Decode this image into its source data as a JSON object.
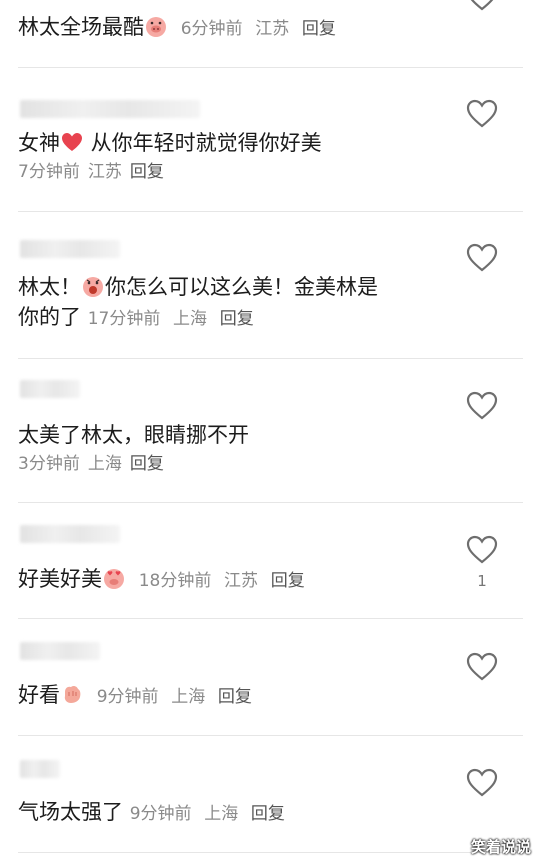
{
  "comments": [
    {
      "text": "林太全场最酷",
      "time": "6分钟前",
      "location": "江苏",
      "reply": "回复",
      "likes": ""
    },
    {
      "text_before": "女神",
      "text_after": " 从你年轻时就觉得你好美",
      "time": "7分钟前",
      "location": "江苏",
      "reply": "回复",
      "likes": ""
    },
    {
      "text_before": "林太！",
      "text_line1_after": "你怎么可以这么美！金美林是",
      "text_line2": "你的了",
      "time": "17分钟前",
      "location": "上海",
      "reply": "回复",
      "likes": ""
    },
    {
      "text": "太美了林太，眼睛挪不开",
      "time": "3分钟前",
      "location": "上海",
      "reply": "回复",
      "likes": ""
    },
    {
      "text": "好美好美",
      "time": "18分钟前",
      "location": "江苏",
      "reply": "回复",
      "likes": "1"
    },
    {
      "text": "好看",
      "time": "9分钟前",
      "location": "上海",
      "reply": "回复",
      "likes": ""
    },
    {
      "text": "气场太强了",
      "time": "9分钟前",
      "location": "上海",
      "reply": "回复",
      "likes": ""
    }
  ],
  "watermark": "笑着说说",
  "icons": {
    "like": "heart-outline-icon",
    "emoji": "pig-face-emoji",
    "heart_emoji": "red-heart-emoji",
    "fist": "fist-emoji"
  },
  "colors": {
    "text": "#1c1c1c",
    "meta": "#8a8a8a",
    "heart_stroke": "#6e6e6e",
    "divider": "#e6e6e6",
    "emoji_heart": "#e8434f"
  }
}
